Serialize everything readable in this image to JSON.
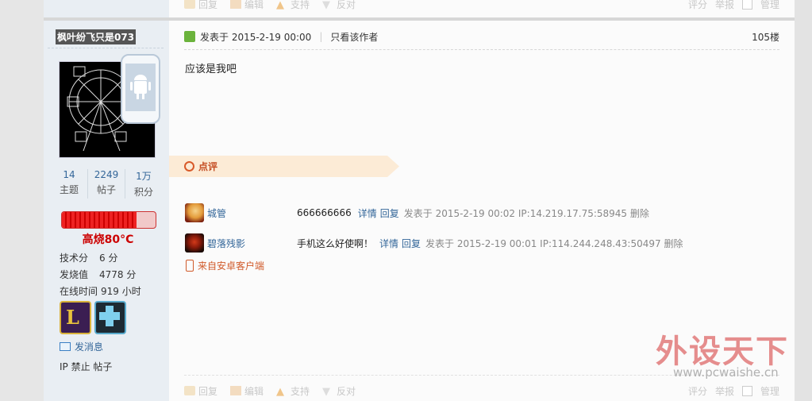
{
  "toolbar": {
    "reply": "回复",
    "edit": "编辑",
    "support": "支持",
    "oppose": "反对",
    "rate": "评分",
    "report": "举报",
    "manage": "管理"
  },
  "user": {
    "name": "枫叶纷飞只是073",
    "stats": [
      {
        "value": "14",
        "label": "主题"
      },
      {
        "value": "2249",
        "label": "帖子"
      },
      {
        "value": "1万",
        "label": "积分"
      }
    ],
    "heat_fraction": 0.8,
    "heat_label": "高烧80°C",
    "info": [
      {
        "label": "技术分",
        "value": "6 分"
      },
      {
        "label": "发烧值",
        "value": "4778 分"
      },
      {
        "label": "在线时间",
        "value": "919 小时"
      }
    ],
    "send_message": "发消息",
    "ip_links": "IP 禁止 帖子"
  },
  "post": {
    "posted_at": "发表于 2015-2-19 00:00",
    "only_author": "只看该作者",
    "floor": "105楼",
    "content": "应该是我吧"
  },
  "comments_header": "点评",
  "comments": [
    {
      "name": "城管",
      "text": "666666666",
      "detail": "详情",
      "reply": "回复",
      "meta": "发表于 2015-2-19 00:02 IP:14.219.17.75:58945 删除"
    },
    {
      "name": "碧落残影",
      "text": "手机这么好使啊！",
      "detail": "详情",
      "reply": "回复",
      "meta": "发表于 2015-2-19 00:01 IP:114.244.248.43:50497 删除"
    }
  ],
  "source": "来自安卓客户端",
  "watermark": {
    "title": "外设天下",
    "url": "www.pcwaishe.cn"
  },
  "colors": {
    "link": "#336699",
    "accent": "#d05a2a",
    "heat": "#cc0000"
  }
}
